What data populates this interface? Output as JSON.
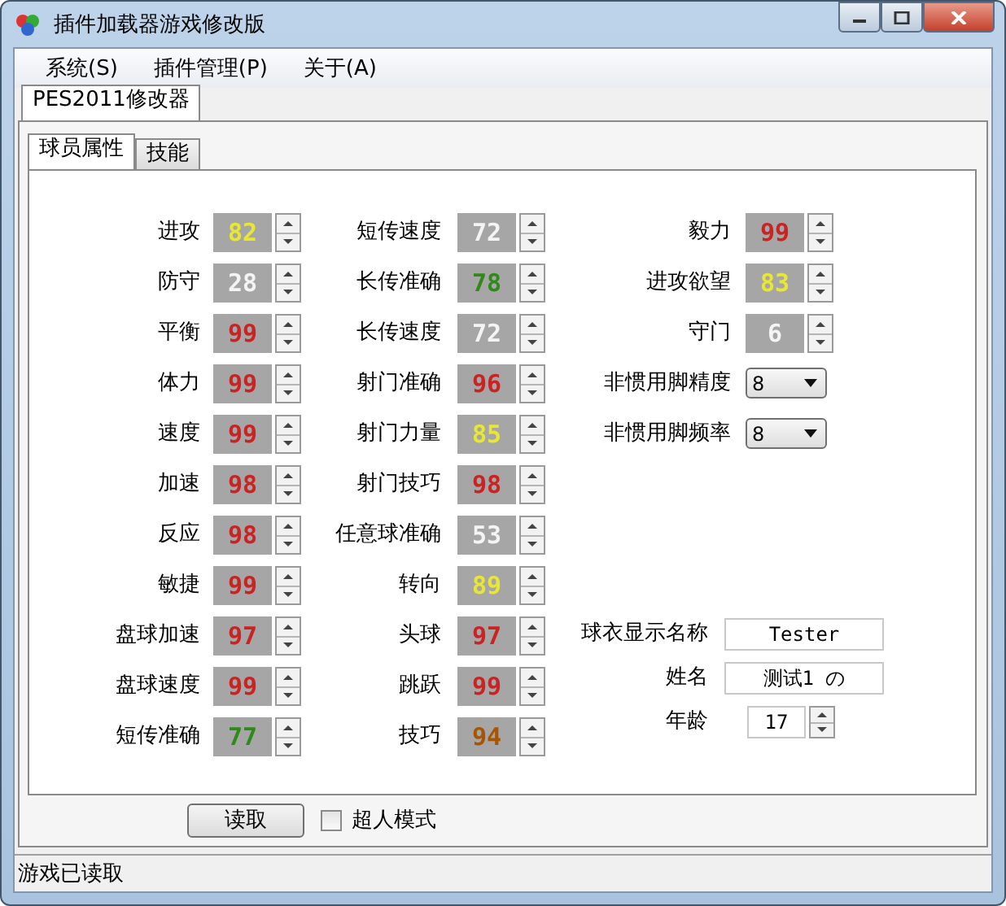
{
  "window": {
    "title": "插件加载器游戏修改版"
  },
  "menu": [
    "系统(S)",
    "插件管理(P)",
    "关于(A)"
  ],
  "outer_tabs": [
    {
      "label": "PES2011修改器",
      "selected": true
    }
  ],
  "inner_tabs": [
    {
      "label": "球员属性",
      "selected": true
    },
    {
      "label": "技能",
      "selected": false
    }
  ],
  "columns": [
    [
      {
        "label": "进攻",
        "value": "82",
        "color": "#e8e830"
      },
      {
        "label": "防守",
        "value": "28",
        "color": "#f4f4f4"
      },
      {
        "label": "平衡",
        "value": "99",
        "color": "#cc2222"
      },
      {
        "label": "体力",
        "value": "99",
        "color": "#cc2222"
      },
      {
        "label": "速度",
        "value": "99",
        "color": "#cc2222"
      },
      {
        "label": "加速",
        "value": "98",
        "color": "#cc2222"
      },
      {
        "label": "反应",
        "value": "98",
        "color": "#cc2222"
      },
      {
        "label": "敏捷",
        "value": "99",
        "color": "#cc2222"
      },
      {
        "label": "盘球加速",
        "value": "97",
        "color": "#cc2222"
      },
      {
        "label": "盘球速度",
        "value": "99",
        "color": "#cc2222"
      },
      {
        "label": "短传准确",
        "value": "77",
        "color": "#2f8a1a"
      }
    ],
    [
      {
        "label": "短传速度",
        "value": "72",
        "color": "#f4f4f4"
      },
      {
        "label": "长传准确",
        "value": "78",
        "color": "#2f8a1a"
      },
      {
        "label": "长传速度",
        "value": "72",
        "color": "#f4f4f4"
      },
      {
        "label": "射门准确",
        "value": "96",
        "color": "#cc2222"
      },
      {
        "label": "射门力量",
        "value": "85",
        "color": "#e8e830"
      },
      {
        "label": "射门技巧",
        "value": "98",
        "color": "#cc2222"
      },
      {
        "label": "任意球准确",
        "value": "53",
        "color": "#f4f4f4"
      },
      {
        "label": "转向",
        "value": "89",
        "color": "#e8e830"
      },
      {
        "label": "头球",
        "value": "97",
        "color": "#cc2222"
      },
      {
        "label": "跳跃",
        "value": "99",
        "color": "#cc2222"
      },
      {
        "label": "技巧",
        "value": "94",
        "color": "#a85400"
      }
    ]
  ],
  "right_column": [
    {
      "kind": "spin",
      "label": "毅力",
      "value": "99",
      "color": "#cc2222"
    },
    {
      "kind": "spin",
      "label": "进攻欲望",
      "value": "83",
      "color": "#e8e830"
    },
    {
      "kind": "spin",
      "label": "守门",
      "value": "6",
      "color": "#f4f4f4"
    },
    {
      "kind": "dropdown",
      "label": "非惯用脚精度",
      "value": "8"
    },
    {
      "kind": "dropdown",
      "label": "非惯用脚频率",
      "value": "8"
    }
  ],
  "player_fields": [
    {
      "kind": "text",
      "label": "球衣显示名称",
      "value": "Tester"
    },
    {
      "kind": "text",
      "label": "姓名",
      "value": "测试1 の"
    },
    {
      "kind": "number",
      "label": "年龄",
      "value": "17"
    }
  ],
  "read_button": "读取",
  "superman_mode": {
    "label": "超人模式",
    "checked": false
  },
  "status_bar": "游戏已读取"
}
